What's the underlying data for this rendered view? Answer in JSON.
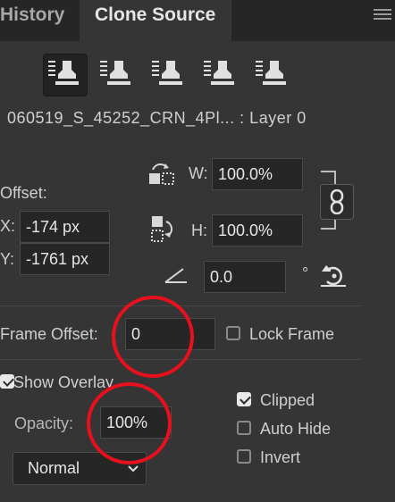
{
  "tabs": {
    "history": "History",
    "clone_source": "Clone Source"
  },
  "menu_icon": "panel-menu-icon",
  "source_buttons": [
    "clone-source-1",
    "clone-source-2",
    "clone-source-3",
    "clone-source-4",
    "clone-source-5"
  ],
  "source_label": "060519_S_45252_CRN_4Pl... : Layer 0",
  "offset": {
    "label": "Offset:",
    "x_label": "X:",
    "x_value": "-174 px",
    "y_label": "Y:",
    "y_value": "-1761 px",
    "w_label": "W:",
    "w_value": "100.0%",
    "h_label": "H:",
    "h_value": "100.0%",
    "angle_value": "0.0",
    "degree_symbol": "°"
  },
  "frame": {
    "label": "Frame Offset:",
    "value": "0",
    "lock_label": "Lock Frame"
  },
  "overlay": {
    "show_label": "Show Overlay",
    "opacity_label": "Opacity:",
    "opacity_value": "100%",
    "mode": "Normal",
    "clipped_label": "Clipped",
    "auto_hide_label": "Auto Hide",
    "invert_label": "Invert"
  },
  "states": {
    "show_overlay": true,
    "clipped": true,
    "auto_hide": false,
    "invert": false,
    "lock_frame": false
  },
  "colors": {
    "panel": "#353535",
    "tabbar": "#262626",
    "field": "#262626",
    "annotation_ring": "#e8101c"
  }
}
